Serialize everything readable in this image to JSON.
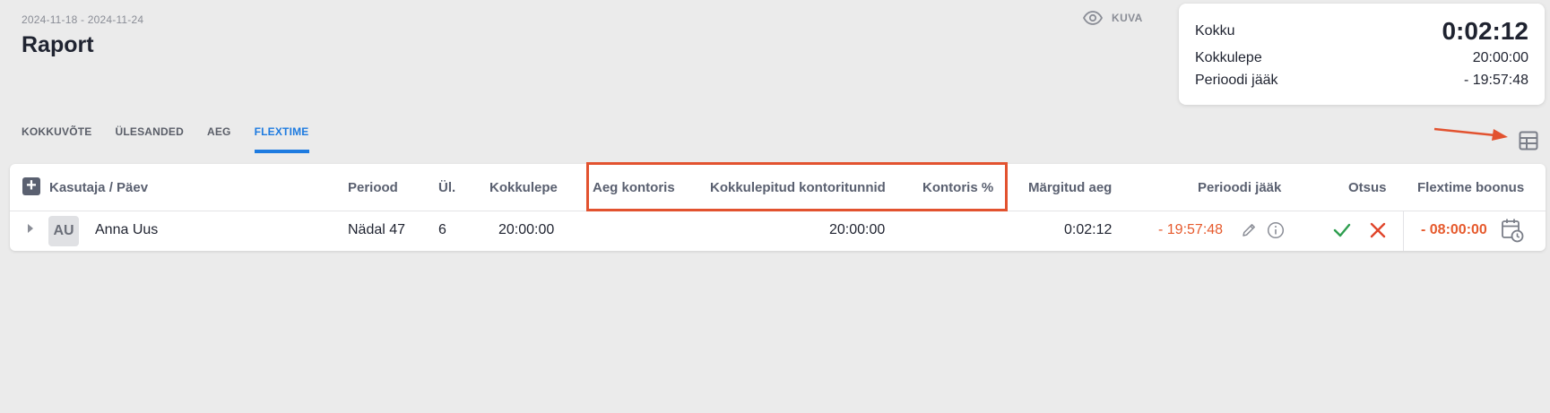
{
  "header": {
    "date_range": "2024-11-18 - 2024-11-24",
    "title": "Raport",
    "view_label": "KUVA"
  },
  "summary": {
    "total_label": "Kokku",
    "total_value": "0:02:12",
    "agreed_label": "Kokkulepe",
    "agreed_value": "20:00:00",
    "remaining_label": "Perioodi jääk",
    "remaining_value": "- 19:57:48"
  },
  "tabs": [
    {
      "label": "KOKKUVÕTE"
    },
    {
      "label": "ÜLESANDED"
    },
    {
      "label": "AEG"
    },
    {
      "label": "FLEXTIME"
    }
  ],
  "table": {
    "columns": {
      "user_day": "Kasutaja / Päev",
      "period": "Periood",
      "tasks": "Ül.",
      "agreed": "Kokkulepe",
      "office_time": "Aeg kontoris",
      "agreed_office_hours": "Kokkulepitud kontoritunnid",
      "office_percent": "Kontoris %",
      "marked_time": "Märgitud aeg",
      "period_remaining": "Perioodi jääk",
      "decision": "Otsus",
      "flextime_bonus": "Flextime boonus"
    },
    "rows": [
      {
        "initials": "AU",
        "name": "Anna Uus",
        "period": "Nädal 47",
        "tasks": "6",
        "agreed": "20:00:00",
        "office_time": "",
        "agreed_office_hours": "20:00:00",
        "office_percent": "",
        "marked_time": "0:02:12",
        "period_remaining": "- 19:57:48",
        "flextime_bonus": "- 08:00:00"
      }
    ]
  },
  "colors": {
    "accent": "#1e7be0",
    "negative": "#e65a2d",
    "highlight": "#e2522f",
    "approve": "#2e9e4f",
    "reject": "#e0452b"
  },
  "icons": [
    "eye-icon",
    "plus-icon",
    "table-grid-icon",
    "pencil-icon",
    "info-icon",
    "check-icon",
    "close-icon",
    "calendar-clock-icon",
    "arrow-icon"
  ]
}
